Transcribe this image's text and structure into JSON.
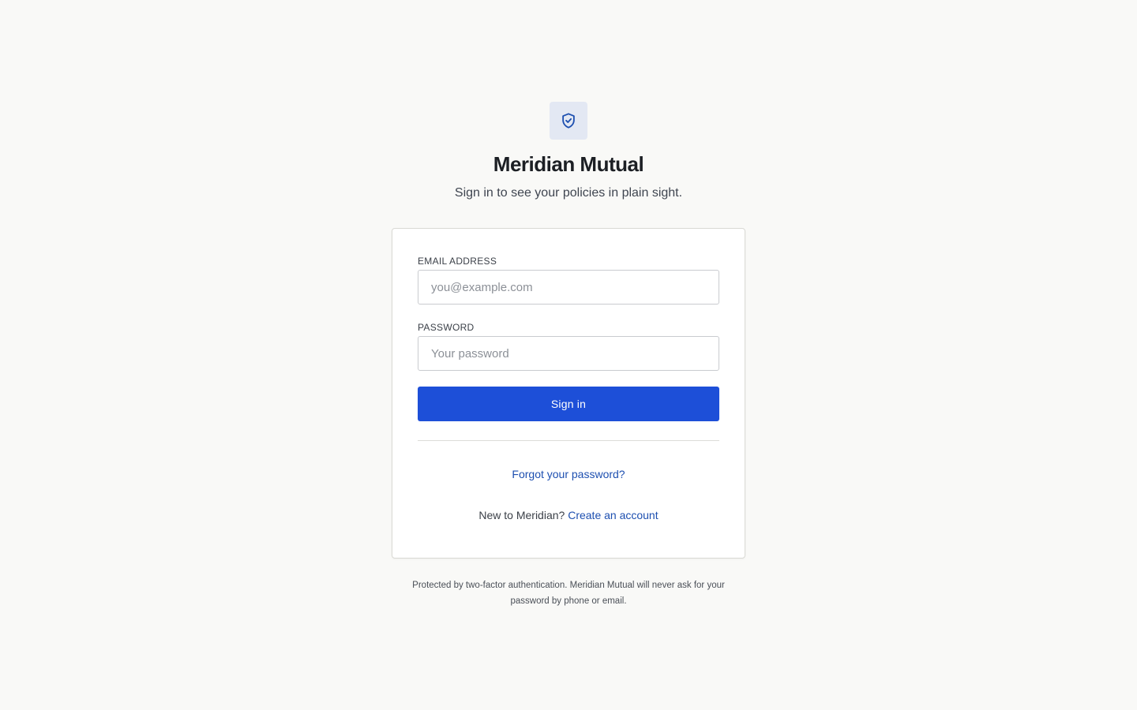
{
  "brand": {
    "icon": "shield-check-icon",
    "name": "Meridian Mutual",
    "tagline": "Sign in to see your policies in plain sight."
  },
  "form": {
    "email_label": "EMAIL ADDRESS",
    "email_value": "",
    "email_placeholder": "you@example.com",
    "password_label": "PASSWORD",
    "password_value": "",
    "password_placeholder": "Your password",
    "submit_label": "Sign in"
  },
  "links": {
    "forgot_password": "Forgot your password?",
    "new_user_prompt": "New to Meridian?",
    "create_account": "Create an account"
  },
  "footer": {
    "note": "Protected by two-factor authentication. Meridian Mutual will never ask for your password by phone or email."
  },
  "colors": {
    "background": "#f9f9f7",
    "accent": "#1d4fd8",
    "link": "#1d4fb0",
    "logo_tile": "#e3e8f3"
  }
}
